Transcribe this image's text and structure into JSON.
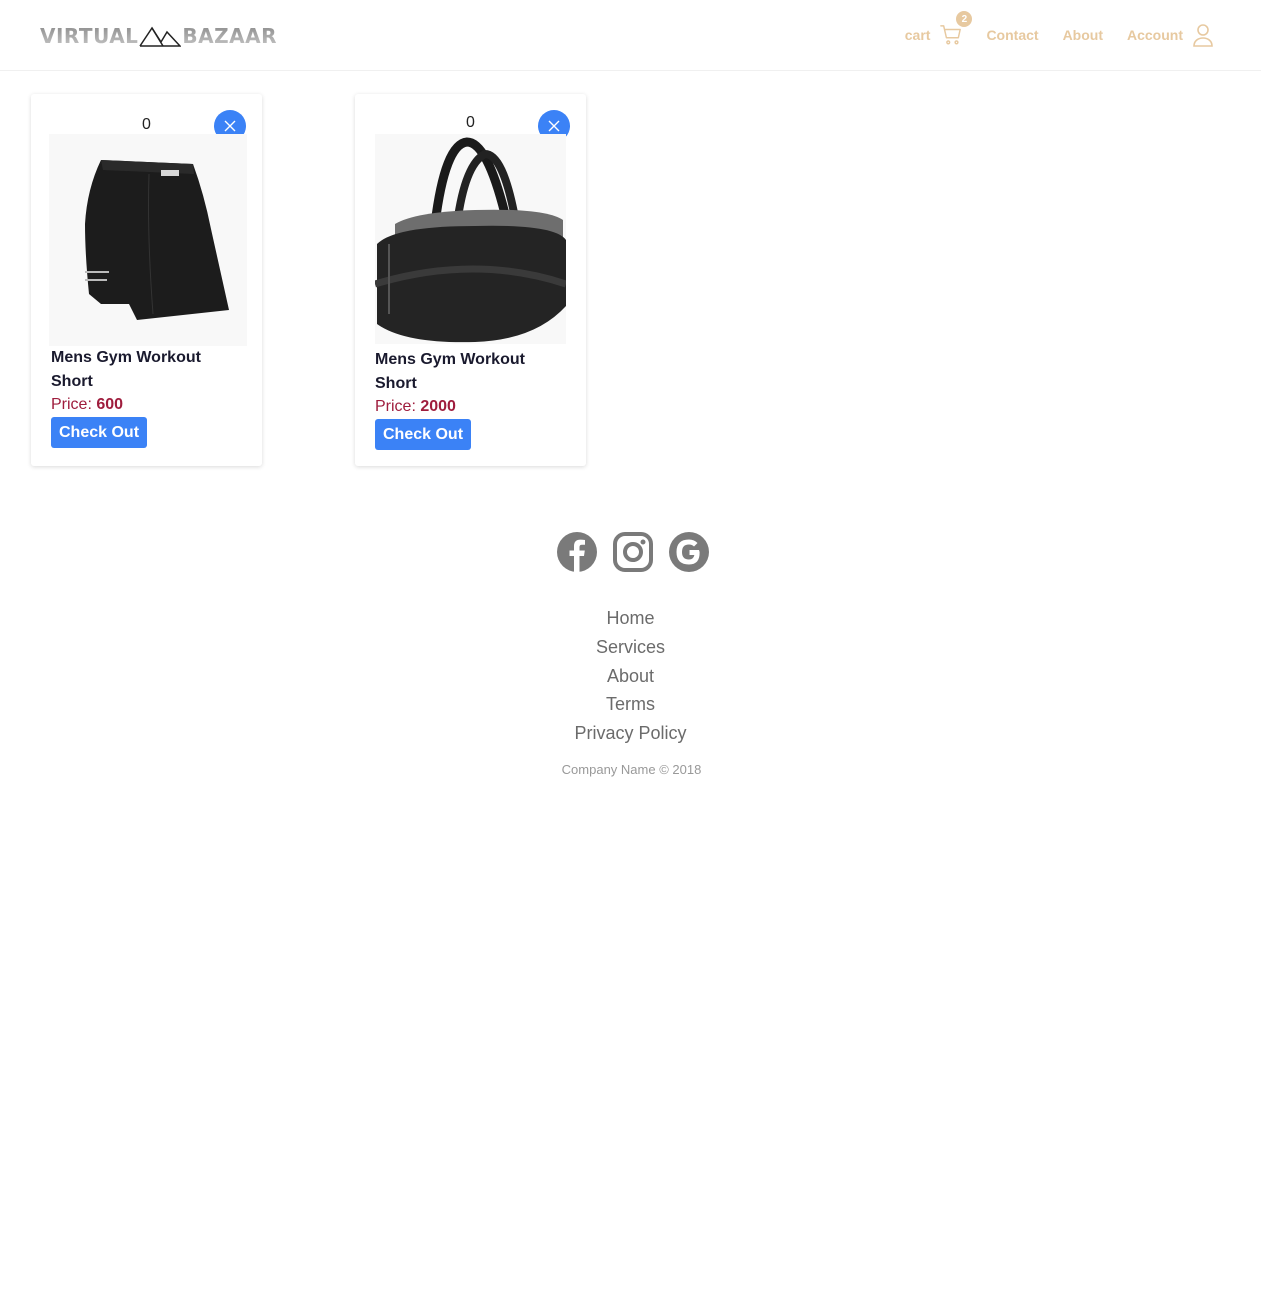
{
  "brand": {
    "left": "VIRTUAL",
    "right": "BAZAAR"
  },
  "nav": {
    "cart_label": "cart",
    "cart_count": "2",
    "contact": "Contact",
    "about": "About",
    "account": "Account",
    "accent_color": "#e7c9a0"
  },
  "cart_items": [
    {
      "qty": "0",
      "name": "Mens Gym Workout Short",
      "price_label": "Price:",
      "price": "600",
      "checkout": "Check Out",
      "image": "black-skirt"
    },
    {
      "qty": "0",
      "name": "Mens Gym Workout Short",
      "price_label": "Price:",
      "price": "2000",
      "checkout": "Check Out",
      "image": "gym-duffel-bag"
    }
  ],
  "footer": {
    "social": [
      "facebook-icon",
      "instagram-icon",
      "google-icon"
    ],
    "links": [
      "Home",
      "Services",
      "About",
      "Terms",
      "Privacy Policy"
    ],
    "copyright": "Company Name © 2018"
  },
  "colors": {
    "primary_button": "#3b82f6",
    "price": "#9f1d3d"
  }
}
